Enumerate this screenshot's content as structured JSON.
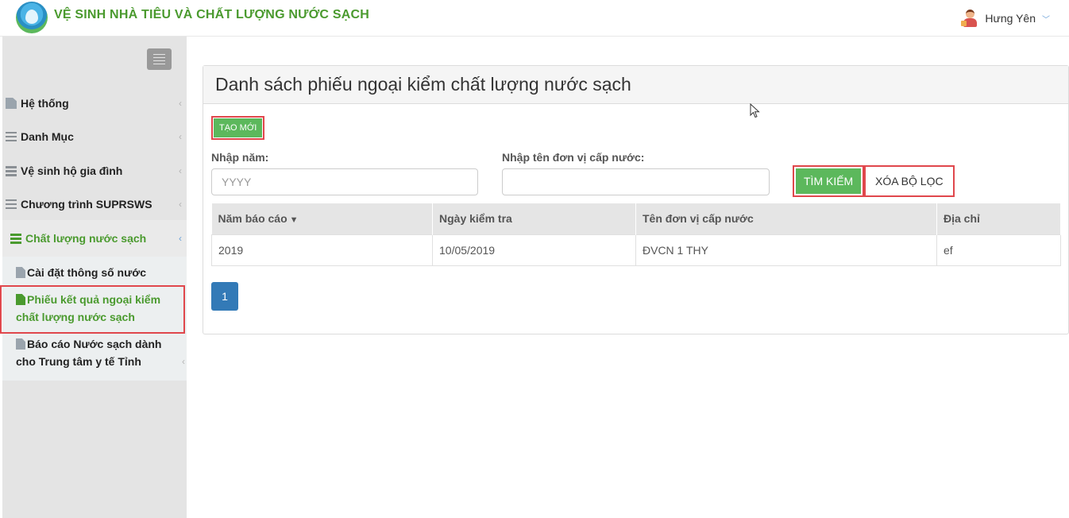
{
  "header": {
    "app_title": "VỆ SINH NHÀ TIÊU VÀ CHẤT LƯỢNG NƯỚC SẠCH",
    "user_name": "Hưng Yên"
  },
  "sidebar": {
    "items": [
      {
        "label": "Hệ thống",
        "icon": "file-icon"
      },
      {
        "label": "Danh Mục",
        "icon": "list-icon"
      },
      {
        "label": "Vệ sinh hộ gia đình",
        "icon": "server-icon"
      },
      {
        "label": "Chương trình SUPRSWS",
        "icon": "list-icon"
      },
      {
        "label": "Chất lượng nước sạch",
        "icon": "server-icon"
      }
    ],
    "subitems": [
      {
        "label": "Cài đặt thông số nước",
        "icon": "file-icon"
      },
      {
        "label": "Phiếu kết quả ngoại kiểm chất lượng nước sạch",
        "icon": "file-icon"
      },
      {
        "label": "Báo cáo Nước sạch dành cho Trung tâm y tế Tỉnh",
        "icon": "file-icon"
      }
    ]
  },
  "main": {
    "title": "Danh sách phiếu ngoại kiểm chất lượng nước sạch",
    "create_button": "TẠO MỚI",
    "year_label": "Nhập năm:",
    "year_placeholder": "YYYY",
    "year_value": "",
    "supplier_label": "Nhập tên đơn vị cấp nước:",
    "supplier_value": "",
    "search_button": "TÌM KIẾM",
    "clear_button": "XÓA BỘ LỌC",
    "table": {
      "columns": [
        "Năm báo cáo",
        "Ngày kiểm tra",
        "Tên đơn vị cấp nước",
        "Địa chỉ"
      ],
      "rows": [
        [
          "2019",
          "10/05/2019",
          "ĐVCN 1 THY",
          "ef"
        ]
      ]
    },
    "pagination": {
      "current_page": "1"
    }
  },
  "colors": {
    "brand_green": "#4a9a2e",
    "button_green": "#5cb85c",
    "highlight_red": "#e0474c",
    "pager_blue": "#337ab7"
  }
}
